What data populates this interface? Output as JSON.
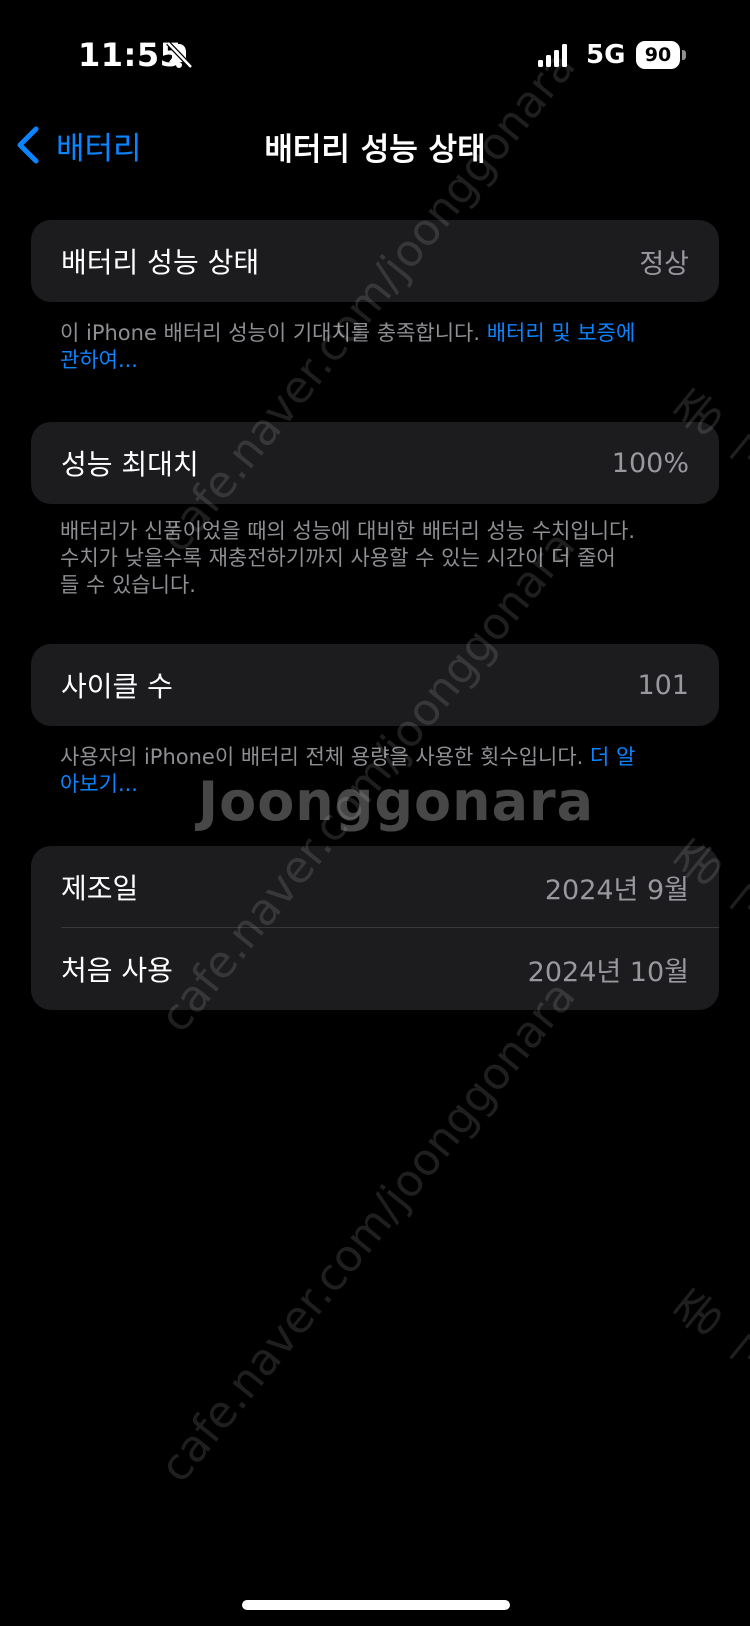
{
  "status_bar": {
    "time": "11:55",
    "network": "5G",
    "battery_level": "90"
  },
  "nav": {
    "back_label": "배터리",
    "title": "배터리 성능 상태"
  },
  "health": {
    "label": "배터리 성능 상태",
    "value": "정상",
    "footer_text": "이 iPhone 배터리 성능이 기대치를 충족합니다. ",
    "footer_link_line1": "배터리 및 보증에",
    "footer_link_line2": "관하여..."
  },
  "max_capacity": {
    "label": "성능 최대치",
    "value": "100%",
    "footer_line1": "배터리가 신품이었을 때의 성능에 대비한 배터리 성능 수치입니다.",
    "footer_line2": "수치가 낮을수록 재충전하기까지 사용할 수 있는 시간이 더 줄어",
    "footer_line3": "들 수 있습니다."
  },
  "cycle_count": {
    "label": "사이클 수",
    "value": "101",
    "footer_text": "사용자의 iPhone이 배터리 전체 용량을 사용한 횟수입니다. ",
    "footer_link_line1": "더 알",
    "footer_link_line2": "아보기..."
  },
  "dates": {
    "manufactured_label": "제조일",
    "manufactured_value": "2024년 9월",
    "first_use_label": "처음 사용",
    "first_use_value": "2024년 10월"
  },
  "watermark": {
    "logo": "Joonggonara",
    "url": "cafe.naver.com/joonggonara",
    "side": "중고"
  },
  "colors": {
    "background": "#000000",
    "cell": "#1c1c1e",
    "accent": "#0a84ff",
    "secondary_text": "#8e8e93"
  }
}
